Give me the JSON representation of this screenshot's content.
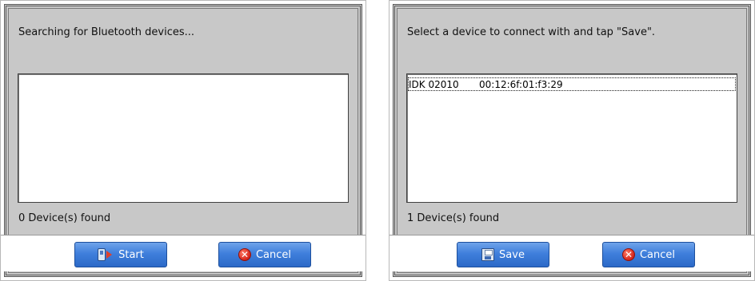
{
  "search_dialog": {
    "message": "Searching for Bluetooth devices...",
    "devices": [],
    "status": "0 Device(s) found",
    "buttons": {
      "start_label": "Start",
      "cancel_label": "Cancel"
    }
  },
  "select_dialog": {
    "message": "Select a device to connect with and tap \"Save\".",
    "devices": [
      {
        "name": "IDK 02010",
        "address": "00:12:6f:01:f3:29"
      }
    ],
    "status": "1 Device(s) found",
    "buttons": {
      "save_label": "Save",
      "cancel_label": "Cancel"
    }
  },
  "icons": {
    "start": "bluetooth-phone-icon",
    "cancel": "cancel-icon",
    "save": "floppy-disk-icon"
  },
  "colors": {
    "dialog_bg": "#c8c8c8",
    "button": "#3f7fdc",
    "cancel_icon": "#d4241a"
  }
}
